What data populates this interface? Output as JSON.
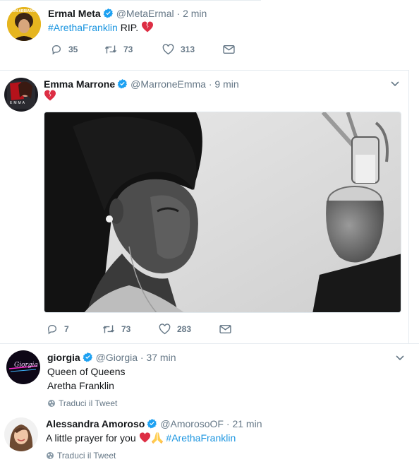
{
  "tweets": [
    {
      "name": "Ermal Meta",
      "handle": "@MetaErmal",
      "time": "2 min",
      "text_hashtag": "#ArethaFranklin",
      "text_plain": " RIP.",
      "avatar_caption": "NON ABBIAMO",
      "replies": "35",
      "retweets": "73",
      "likes": "313"
    },
    {
      "name": "Emma Marrone",
      "handle": "@MarroneEmma",
      "time": "9 min",
      "avatar_caption": "EMMA",
      "replies": "7",
      "retweets": "73",
      "likes": "283"
    },
    {
      "name": "giorgia",
      "handle": "@Giorgia",
      "time": "37 min",
      "line1": "Queen of Queens",
      "line2": "Aretha Franklin",
      "translate": "Traduci il Tweet",
      "avatar_caption": "Giorgia"
    },
    {
      "name": "Alessandra Amoroso",
      "handle": "@AmorosoOF",
      "time": "21 min",
      "text_plain": "A little prayer for you ",
      "text_hashtag": "#ArethaFranklin",
      "translate": "Traduci il Tweet"
    }
  ],
  "separator": "·",
  "colors": {
    "link": "#1b95e0",
    "muted": "#657786",
    "verified": "#1da1f2",
    "heart_broken": "#dd2e44"
  },
  "icons": [
    "reply-icon",
    "retweet-icon",
    "like-icon",
    "direct-message-icon",
    "verified-badge-icon",
    "chevron-down-icon",
    "globe-icon",
    "broken-heart-emoji",
    "red-heart-emoji",
    "praying-hands-emoji"
  ]
}
